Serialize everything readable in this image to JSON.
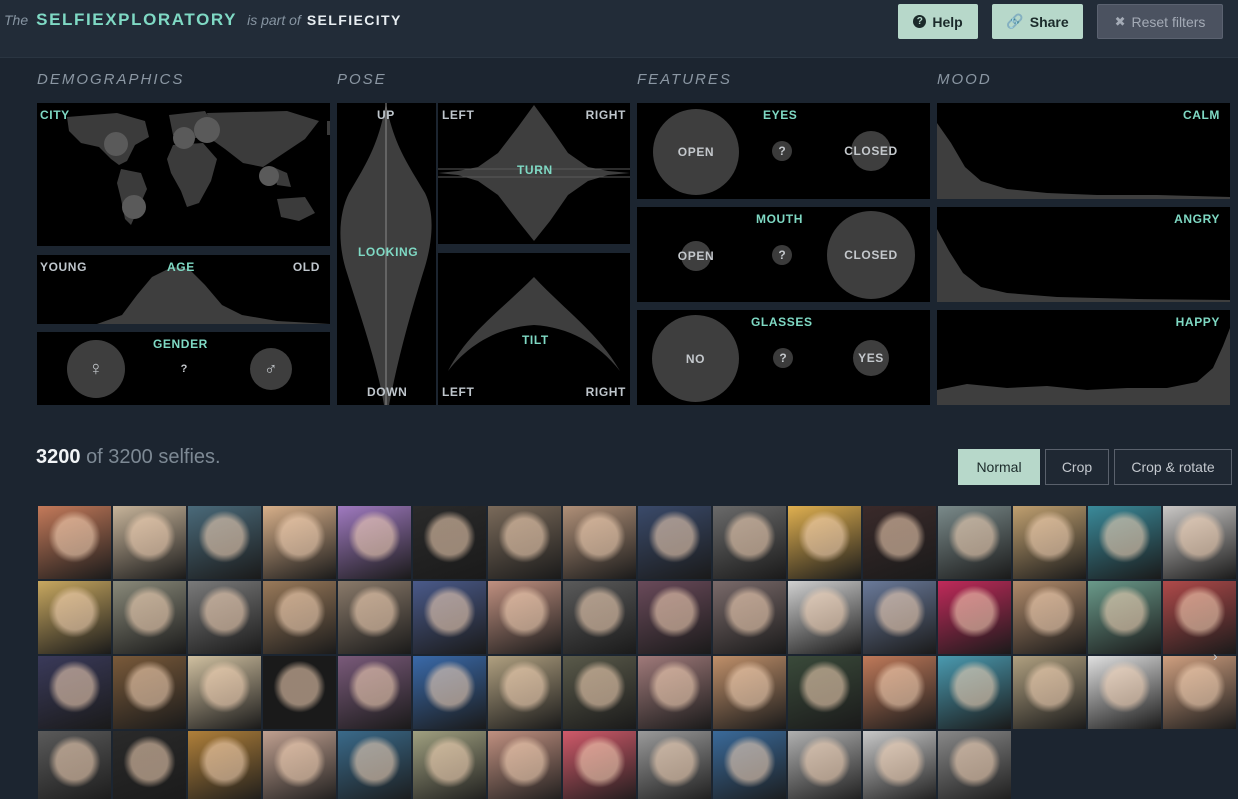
{
  "header": {
    "the": "The",
    "app_name": "SELFIEXPLORATORY",
    "is_part_of": "is part of",
    "parent": "SELFIECITY",
    "help": "Help",
    "share": "Share",
    "reset": "Reset filters"
  },
  "sections": {
    "demographics": "DEMOGRAPHICS",
    "pose": "POSE",
    "features": "FEATURES",
    "mood": "MOOD"
  },
  "demographics": {
    "city": "CITY",
    "young": "YOUNG",
    "age": "AGE",
    "old": "OLD",
    "gender": "GENDER",
    "female": "♀",
    "unknown": "?",
    "male": "♂"
  },
  "pose": {
    "up": "UP",
    "looking": "LOOKING",
    "down": "DOWN",
    "left": "LEFT",
    "right": "RIGHT",
    "turn": "TURN",
    "tilt": "TILT"
  },
  "features": {
    "eyes": {
      "label": "EYES",
      "open": "OPEN",
      "unknown": "?",
      "closed": "CLOSED"
    },
    "mouth": {
      "label": "MOUTH",
      "open": "OPEN",
      "unknown": "?",
      "closed": "CLOSED"
    },
    "glasses": {
      "label": "GLASSES",
      "no": "NO",
      "unknown": "?",
      "yes": "YES"
    }
  },
  "mood": {
    "calm": "CALM",
    "angry": "ANGRY",
    "happy": "HAPPY"
  },
  "results": {
    "shown": "3200",
    "total_text": "of 3200 selfies."
  },
  "view_modes": {
    "normal": "Normal",
    "crop": "Crop",
    "crop_rotate": "Crop & rotate",
    "selected": "Normal"
  },
  "colors": {
    "accent": "#7fd9c4",
    "button": "#b7d8ca",
    "background": "#1c2530"
  },
  "thumbnails": [
    "#c47a5a",
    "#c7b49a",
    "#4a6a7a",
    "#d8b08a",
    "#a07ac0",
    "#2a2a2a",
    "#7a6a5a",
    "#b09078",
    "#3a4a6a",
    "#6a6a6a",
    "#e0b050",
    "#3a2a2a",
    "#7a8a8a",
    "#c0a070",
    "#3a8a9a",
    "#cac8c6",
    "#3a3a3a",
    "#c8a860",
    "#8a8a7a",
    "#7a7a7a",
    "#9a7a5a",
    "#8a7a6a",
    "#4a5a8a",
    "#c09080",
    "#5a5a5a",
    "#6a4a5a",
    "#7a6a6a",
    "#d0d0d0",
    "#6a7a9a",
    "#c02a5a",
    "#b08a6a",
    "#6a9a8a",
    "#b04a4a",
    "#8a4ab0",
    "#3a3a5a",
    "#7a5a3a",
    "#d0c0a0",
    "#1a1a1a",
    "#7a5a7a",
    "#3a6aaa",
    "#b0a080",
    "#5a5a4a",
    "#a07a7a",
    "#c0906a",
    "#3a4a3a",
    "#c07a5a",
    "#4a9ab0",
    "#b0a080",
    "#e0e0e0",
    "#d0a080",
    "#9a9a9a",
    "#5a5a5a",
    "#2a2a2a",
    "#b0803a",
    "#c0a090",
    "#3a6a8a",
    "#a0a080",
    "#c09080",
    "#d05a6a",
    "#9a9a9a",
    "#3a6a9a",
    "#b0b0b0",
    "#c8c8c8",
    "#888888"
  ],
  "icons": {
    "help": "question-circle-icon",
    "share": "link-icon",
    "reset": "close-icon",
    "next": "chevron-right-icon"
  }
}
